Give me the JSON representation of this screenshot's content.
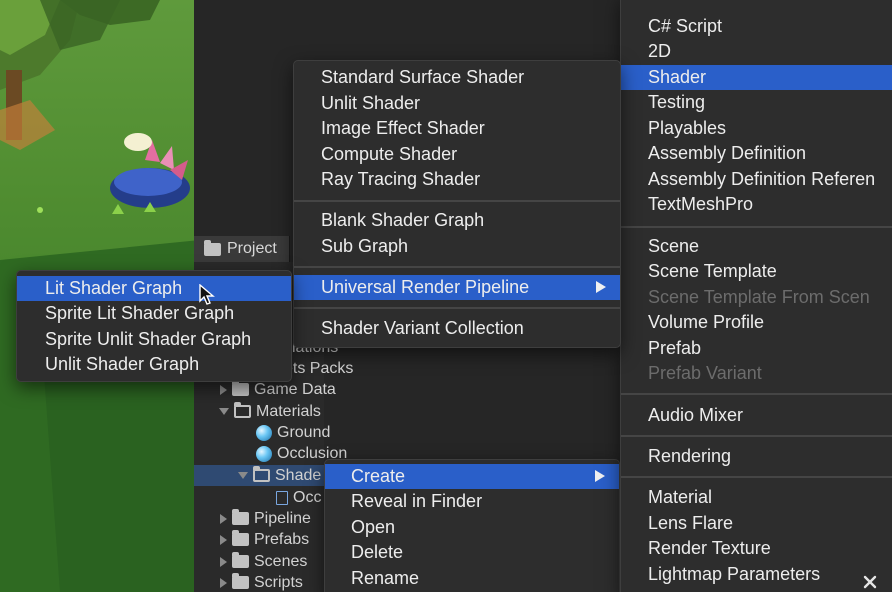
{
  "project_panel": {
    "tab_label": "Project",
    "tree": [
      {
        "label": "lations",
        "kind": "none"
      },
      {
        "label": "ets Packs",
        "kind": "none"
      },
      {
        "label": "Game Data",
        "kind": "folder"
      },
      {
        "label": "Materials",
        "kind": "folder-open"
      },
      {
        "label": "Ground",
        "kind": "material"
      },
      {
        "label": "Occlusion",
        "kind": "material"
      },
      {
        "label": "Shade",
        "kind": "folder-open"
      },
      {
        "label": "Occ",
        "kind": "shader"
      },
      {
        "label": "Pipeline",
        "kind": "folder"
      },
      {
        "label": "Prefabs",
        "kind": "folder"
      },
      {
        "label": "Scenes",
        "kind": "folder"
      },
      {
        "label": "Scripts",
        "kind": "folder"
      }
    ]
  },
  "context_menu": {
    "items": [
      {
        "label": "Create",
        "selected": true,
        "submenu": true
      },
      {
        "label": "Reveal in Finder"
      },
      {
        "label": "Open"
      },
      {
        "label": "Delete"
      },
      {
        "label": "Rename"
      }
    ]
  },
  "create_menu": {
    "items": [
      {
        "label": "C# Script"
      },
      {
        "label": "2D"
      },
      {
        "label": "Shader",
        "selected": true
      },
      {
        "label": "Testing"
      },
      {
        "label": "Playables"
      },
      {
        "label": "Assembly Definition"
      },
      {
        "label": "Assembly Definition Referen"
      },
      {
        "label": "TextMeshPro"
      },
      {
        "label": "Scene"
      },
      {
        "label": "Scene Template"
      },
      {
        "label": "Scene Template From Scen",
        "disabled": true
      },
      {
        "label": "Volume Profile"
      },
      {
        "label": "Prefab"
      },
      {
        "label": "Prefab Variant",
        "disabled": true
      },
      {
        "label": "Audio Mixer"
      },
      {
        "label": "Rendering"
      },
      {
        "label": "Material"
      },
      {
        "label": "Lens Flare"
      },
      {
        "label": "Render Texture"
      },
      {
        "label": "Lightmap Parameters"
      }
    ]
  },
  "shader_menu": {
    "items": [
      {
        "label": "Standard Surface Shader"
      },
      {
        "label": "Unlit Shader"
      },
      {
        "label": "Image Effect Shader"
      },
      {
        "label": "Compute Shader"
      },
      {
        "label": "Ray Tracing Shader"
      },
      {
        "label": "Blank Shader Graph"
      },
      {
        "label": "Sub Graph"
      },
      {
        "label": "Universal Render Pipeline",
        "selected": true,
        "submenu": true
      },
      {
        "label": "Shader Variant Collection"
      }
    ]
  },
  "urp_menu": {
    "items": [
      {
        "label": "Lit Shader Graph",
        "selected": true
      },
      {
        "label": "Sprite Lit Shader Graph"
      },
      {
        "label": "Sprite Unlit Shader Graph"
      },
      {
        "label": "Unlit Shader Graph"
      }
    ]
  },
  "colors": {
    "selection": "#2a5fc9",
    "menu_bg": "#2d2d2d",
    "disabled_text": "#6c6c6c"
  }
}
